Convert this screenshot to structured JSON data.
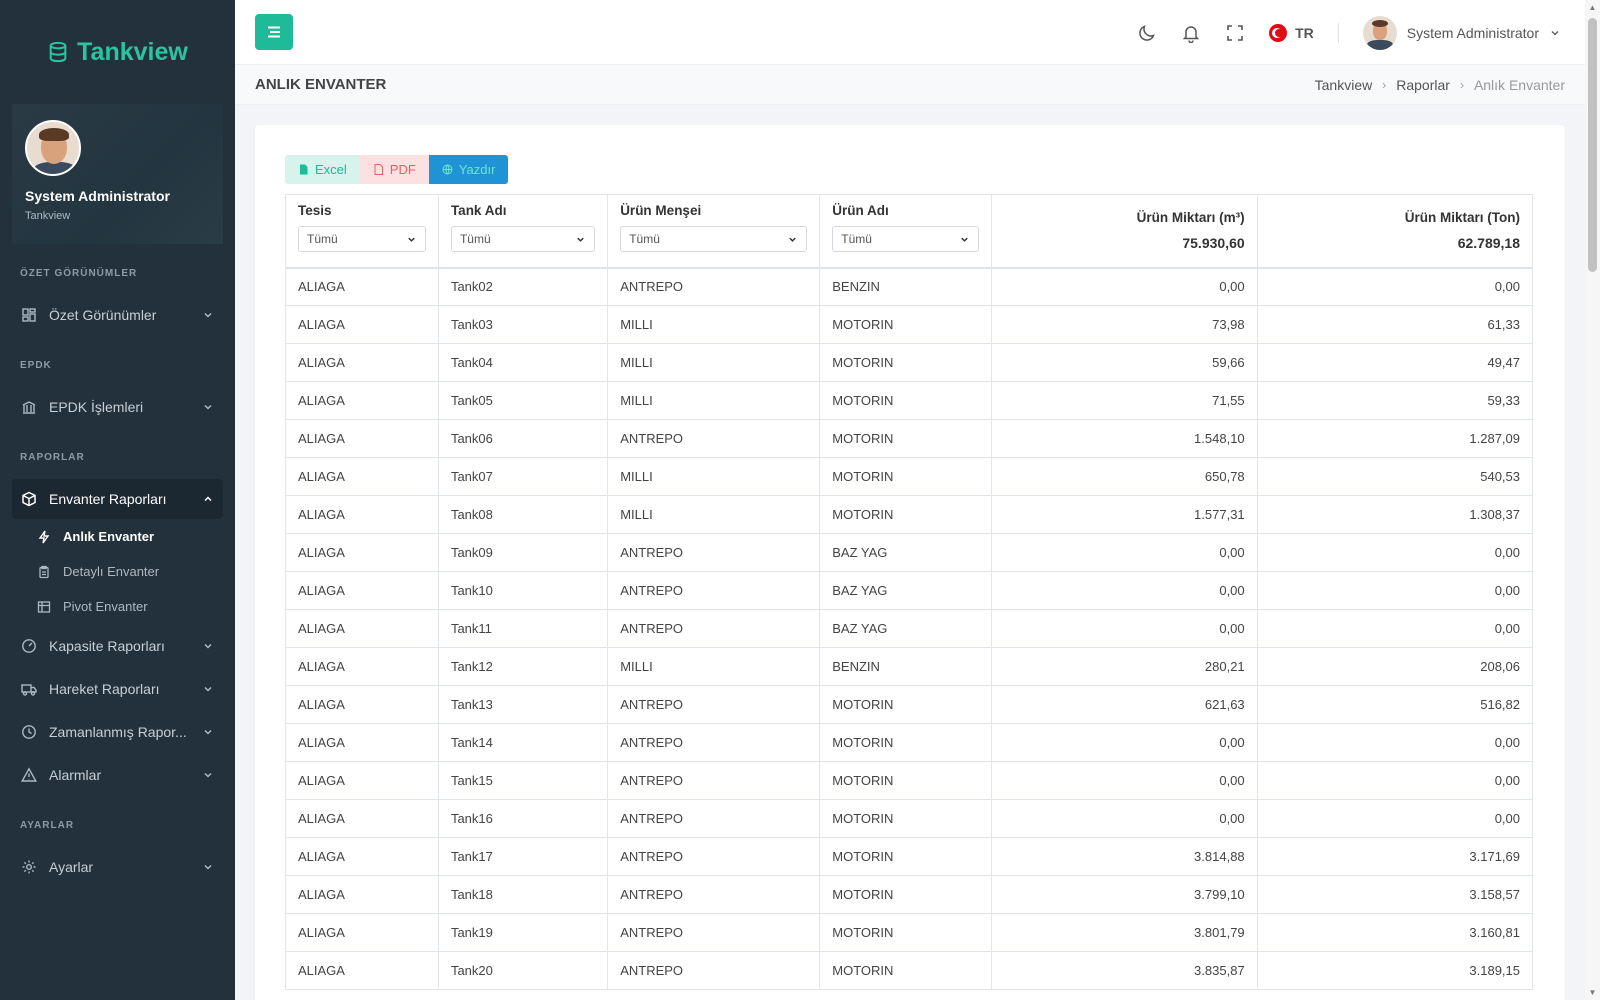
{
  "app": {
    "name": "Tankview"
  },
  "profile": {
    "name": "System Administrator",
    "role": "Tankview"
  },
  "sidebar": {
    "sections": [
      {
        "title": "ÖZET GÖRÜNÜMLER"
      },
      {
        "title": "EPDK"
      },
      {
        "title": "RAPORLAR"
      },
      {
        "title": "AYARLAR"
      }
    ],
    "items": [
      {
        "label": "Özet Görünümler",
        "icon": "dashboard-icon"
      },
      {
        "label": "EPDK İşlemleri",
        "icon": "bank-icon"
      },
      {
        "label": "Envanter Raporları",
        "icon": "cube-icon"
      },
      {
        "label": "Kapasite Raporları",
        "icon": "gauge-icon"
      },
      {
        "label": "Hareket Raporları",
        "icon": "truck-icon"
      },
      {
        "label": "Zamanlanmış Rapor...",
        "icon": "clock-icon"
      },
      {
        "label": "Alarmlar",
        "icon": "warning-icon"
      },
      {
        "label": "Ayarlar",
        "icon": "gear-icon"
      }
    ],
    "subitems": [
      {
        "label": "Anlık Envanter",
        "icon": "bolt-icon"
      },
      {
        "label": "Detaylı Envanter",
        "icon": "clipboard-icon"
      },
      {
        "label": "Pivot Envanter",
        "icon": "table-icon"
      }
    ]
  },
  "header": {
    "lang": "TR",
    "user": "System Administrator"
  },
  "page": {
    "title": "ANLIK ENVANTER"
  },
  "breadcrumb": [
    "Tankview",
    "Raporlar",
    "Anlık Envanter"
  ],
  "toolbar": {
    "excel": "Excel",
    "pdf": "PDF",
    "print": "Yazdır"
  },
  "table": {
    "columns": [
      {
        "label": "Tesis",
        "filter": "Tümü"
      },
      {
        "label": "Tank Adı",
        "filter": "Tümü"
      },
      {
        "label": "Ürün Menşei",
        "filter": "Tümü"
      },
      {
        "label": "Ürün Adı",
        "filter": "Tümü"
      },
      {
        "label": "Ürün Miktarı (m³)",
        "total": "75.930,60"
      },
      {
        "label": "Ürün Miktarı (Ton)",
        "total": "62.789,18"
      }
    ],
    "rows": [
      [
        "ALIAGA",
        "Tank02",
        "ANTREPO",
        "BENZIN",
        "0,00",
        "0,00"
      ],
      [
        "ALIAGA",
        "Tank03",
        "MILLI",
        "MOTORIN",
        "73,98",
        "61,33"
      ],
      [
        "ALIAGA",
        "Tank04",
        "MILLI",
        "MOTORIN",
        "59,66",
        "49,47"
      ],
      [
        "ALIAGA",
        "Tank05",
        "MILLI",
        "MOTORIN",
        "71,55",
        "59,33"
      ],
      [
        "ALIAGA",
        "Tank06",
        "ANTREPO",
        "MOTORIN",
        "1.548,10",
        "1.287,09"
      ],
      [
        "ALIAGA",
        "Tank07",
        "MILLI",
        "MOTORIN",
        "650,78",
        "540,53"
      ],
      [
        "ALIAGA",
        "Tank08",
        "MILLI",
        "MOTORIN",
        "1.577,31",
        "1.308,37"
      ],
      [
        "ALIAGA",
        "Tank09",
        "ANTREPO",
        "BAZ YAG",
        "0,00",
        "0,00"
      ],
      [
        "ALIAGA",
        "Tank10",
        "ANTREPO",
        "BAZ YAG",
        "0,00",
        "0,00"
      ],
      [
        "ALIAGA",
        "Tank11",
        "ANTREPO",
        "BAZ YAG",
        "0,00",
        "0,00"
      ],
      [
        "ALIAGA",
        "Tank12",
        "MILLI",
        "BENZIN",
        "280,21",
        "208,06"
      ],
      [
        "ALIAGA",
        "Tank13",
        "ANTREPO",
        "MOTORIN",
        "621,63",
        "516,82"
      ],
      [
        "ALIAGA",
        "Tank14",
        "ANTREPO",
        "MOTORIN",
        "0,00",
        "0,00"
      ],
      [
        "ALIAGA",
        "Tank15",
        "ANTREPO",
        "MOTORIN",
        "0,00",
        "0,00"
      ],
      [
        "ALIAGA",
        "Tank16",
        "ANTREPO",
        "MOTORIN",
        "0,00",
        "0,00"
      ],
      [
        "ALIAGA",
        "Tank17",
        "ANTREPO",
        "MOTORIN",
        "3.814,88",
        "3.171,69"
      ],
      [
        "ALIAGA",
        "Tank18",
        "ANTREPO",
        "MOTORIN",
        "3.799,10",
        "3.158,57"
      ],
      [
        "ALIAGA",
        "Tank19",
        "ANTREPO",
        "MOTORIN",
        "3.801,79",
        "3.160,81"
      ],
      [
        "ALIAGA",
        "Tank20",
        "ANTREPO",
        "MOTORIN",
        "3.835,87",
        "3.189,15"
      ]
    ]
  },
  "colors": {
    "accent": "#1fba98",
    "sidebar": "#22313c",
    "print": "#1f93d6"
  }
}
